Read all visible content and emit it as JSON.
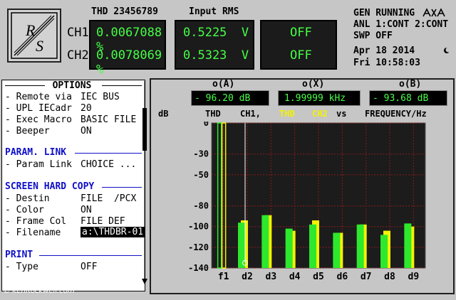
{
  "header": {
    "thd_title": "THD 23456789",
    "rms_title": "Input RMS",
    "ch1_label": "CH1",
    "ch2_label": "CH2",
    "ch1_thd_value": "0.0067088 %",
    "ch2_thd_value": "0.0078069 %",
    "ch1_rms_value": "0.5225  V",
    "ch2_rms_value": "0.5323  V",
    "third_display_1": "OFF",
    "third_display_2": "OFF",
    "status_line_1": "GEN RUNNING",
    "status_line_2": "ANL 1:CONT 2:CONT",
    "status_line_3": "SWP OFF",
    "date": "Apr 18 2014",
    "time": "Fri 10:58:03",
    "logo_text": "R&S"
  },
  "options": {
    "title": "OPTIONS",
    "rows_general": [
      {
        "label": "- Remote via",
        "value": "IEC BUS"
      },
      {
        "label": "- UPL IECadr",
        "value": "20"
      },
      {
        "label": "- Exec Macro",
        "value": "BASIC FILE"
      },
      {
        "label": "- Beeper",
        "value": "ON"
      }
    ],
    "section_param": "PARAM. LINK",
    "rows_param": [
      {
        "label": "- Param Link",
        "value": "CHOICE ..."
      }
    ],
    "section_screen": "SCREEN HARD COPY",
    "rows_screen": [
      {
        "label": "- Destin",
        "value": "FILE  /PCX"
      },
      {
        "label": "- Color",
        "value": "ON"
      },
      {
        "label": "- Frame Col",
        "value": "FILE DEF"
      },
      {
        "label": "- Filename",
        "value": "a:\\THDBR-01"
      }
    ],
    "section_print": "PRINT",
    "rows_print": [
      {
        "label": "- Type",
        "value": "OFF"
      }
    ]
  },
  "graph": {
    "readout_a_label": "o(A)",
    "readout_x_label": "o(X)",
    "readout_b_label": "o(B)",
    "readout_a_value": "- 96.20 dB",
    "readout_x_value": "1.99999 kHz",
    "readout_b_value": "- 93.68 dB",
    "db_label": "dB",
    "legend_thd": "THD",
    "legend_ch1": "CH1,",
    "legend_thd_yellow": "THD",
    "legend_ch2": "CH2",
    "legend_vs": "vs",
    "legend_freq": "FREQUENCY/Hz",
    "colors": {
      "ch1": "#2de82d",
      "ch2": "#f2f200",
      "lcd_text": "#46ff46",
      "background": "#1e1e1e",
      "grid": "#8a1a1a",
      "section_blue": "#1010c8"
    }
  },
  "chart_data": {
    "type": "bar",
    "categories": [
      "f1",
      "d2",
      "d3",
      "d4",
      "d5",
      "d6",
      "d7",
      "d8",
      "d9"
    ],
    "series": [
      {
        "name": "CH1",
        "values": [
          0,
          -96.2,
          -89,
          -102,
          -98,
          -106,
          -98,
          -108,
          -97
        ]
      },
      {
        "name": "CH2",
        "values": [
          0,
          -94,
          -89,
          -104,
          -94,
          -106,
          -98,
          -104,
          -100
        ]
      }
    ],
    "ylabel": "dB",
    "yticks": [
      0,
      -30,
      -50,
      -80,
      -100,
      -120,
      -140
    ],
    "ylim": [
      -140,
      0
    ]
  },
  "footer": {
    "credit": "© KenRockwell.com"
  }
}
